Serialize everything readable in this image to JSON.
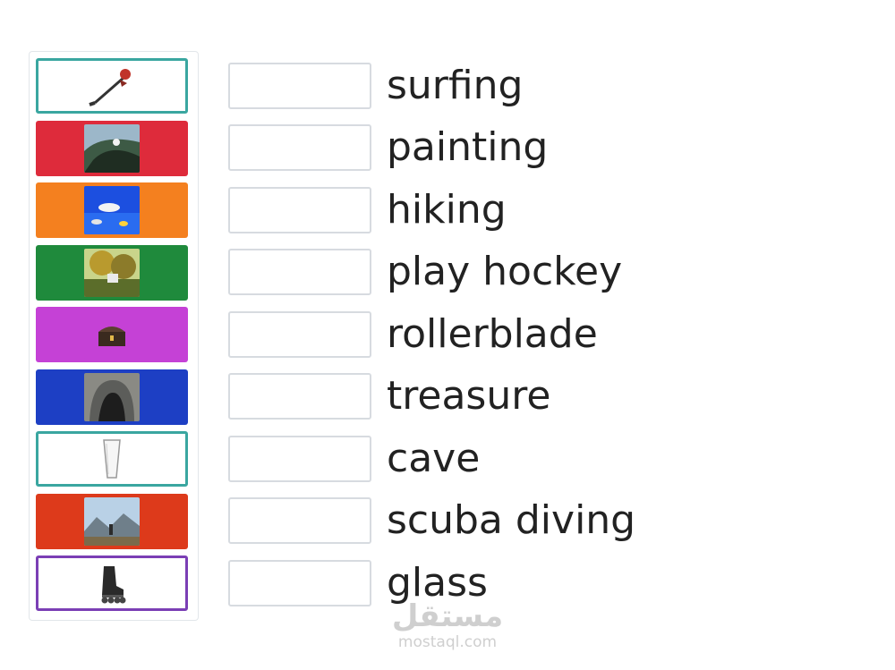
{
  "words": [
    "surfing",
    "painting",
    "hiking",
    "play hockey",
    "rollerblade",
    "treasure",
    "cave",
    "scuba diving",
    "glass"
  ],
  "tiles": [
    {
      "bg": "#ffffff",
      "border": "#3aa6a0",
      "picture": "hockey-stick-icon"
    },
    {
      "bg": "#de2b3b",
      "picture": "surfing-photo"
    },
    {
      "bg": "#f4801f",
      "picture": "scuba-diving-photo"
    },
    {
      "bg": "#1f8a3c",
      "picture": "painting-photo"
    },
    {
      "bg": "#c541d6",
      "picture": "treasure-chest-icon"
    },
    {
      "bg": "#1d3fc4",
      "picture": "cave-photo"
    },
    {
      "bg": "#ffffff",
      "border": "#3aa6a0",
      "picture": "glass-icon"
    },
    {
      "bg": "#dd3a1b",
      "picture": "hiking-photo"
    },
    {
      "bg": "#ffffff",
      "border": "#7b3fb5",
      "picture": "rollerblade-icon"
    }
  ],
  "watermark": {
    "logo": "مستقل",
    "site": "mostaql.com"
  }
}
